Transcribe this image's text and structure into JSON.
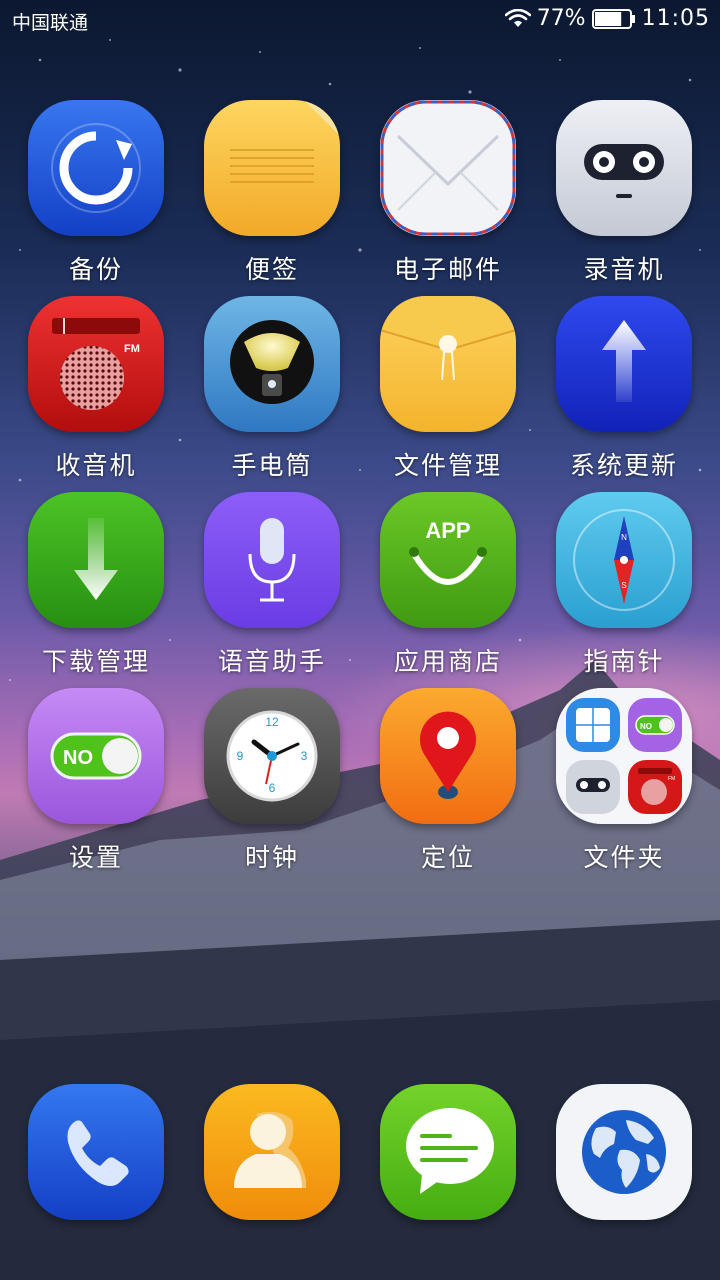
{
  "status_bar": {
    "carrier": "中国联通",
    "battery_percent": "77%",
    "battery_level": 0.77,
    "time": "11:05",
    "icons": [
      "wifi-icon",
      "battery-icon"
    ]
  },
  "apps": [
    {
      "id": "backup",
      "label": "备份",
      "icon": "backup-icon"
    },
    {
      "id": "notes",
      "label": "便签",
      "icon": "notes-icon"
    },
    {
      "id": "email",
      "label": "电子邮件",
      "icon": "email-icon"
    },
    {
      "id": "recorder",
      "label": "录音机",
      "icon": "recorder-icon"
    },
    {
      "id": "radio",
      "label": "收音机",
      "icon": "radio-icon",
      "icon_text": "FM"
    },
    {
      "id": "flashlight",
      "label": "手电筒",
      "icon": "flashlight-icon"
    },
    {
      "id": "file-manager",
      "label": "文件管理",
      "icon": "file-manager-icon"
    },
    {
      "id": "system-update",
      "label": "系统更新",
      "icon": "system-update-icon"
    },
    {
      "id": "download-manager",
      "label": "下载管理",
      "icon": "download-icon"
    },
    {
      "id": "voice-assistant",
      "label": "语音助手",
      "icon": "microphone-icon"
    },
    {
      "id": "app-store",
      "label": "应用商店",
      "icon": "app-store-icon",
      "icon_text": "APP"
    },
    {
      "id": "compass",
      "label": "指南针",
      "icon": "compass-icon",
      "icon_text_n": "N",
      "icon_text_s": "S"
    },
    {
      "id": "settings",
      "label": "设置",
      "icon": "settings-toggle-icon",
      "icon_text": "NO"
    },
    {
      "id": "clock",
      "label": "时钟",
      "icon": "clock-icon",
      "dial_12": "12",
      "dial_3": "3",
      "dial_6": "6",
      "dial_9": "9"
    },
    {
      "id": "location",
      "label": "定位",
      "icon": "location-pin-icon"
    },
    {
      "id": "folder",
      "label": "文件夹",
      "icon": "folder-icon",
      "mini_toggle_text": "NO",
      "mini_fm_text": "FM"
    }
  ],
  "dock": [
    {
      "id": "phone",
      "icon": "phone-icon"
    },
    {
      "id": "contacts",
      "icon": "contacts-icon"
    },
    {
      "id": "messages",
      "icon": "messages-icon"
    },
    {
      "id": "browser",
      "icon": "globe-icon"
    }
  ],
  "colors": {
    "backup": "#1a4fd8",
    "notes": "#f7be3c",
    "recorder": "#d9dde6",
    "radio": "#d41818",
    "system_update": "#1c2fd6",
    "download": "#35a31a",
    "voice": "#7c4ef0",
    "app_store": "#56b51e",
    "compass": "#38b6de",
    "settings": "#b26be8",
    "location": "#f78a1c",
    "phone": "#1a52d8",
    "contacts": "#f5a514",
    "messages": "#56c51a"
  }
}
